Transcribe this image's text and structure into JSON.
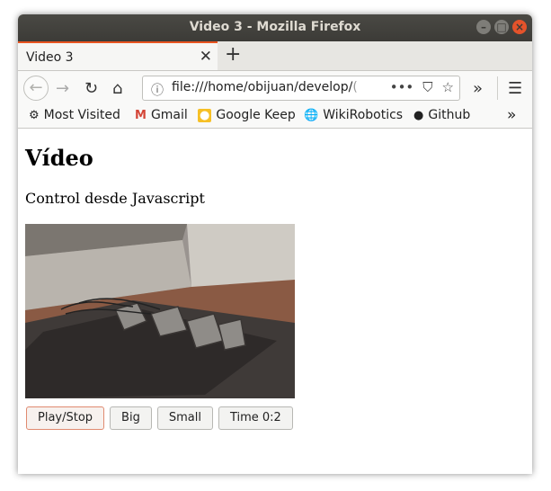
{
  "window": {
    "title": "Video 3 - Mozilla Firefox"
  },
  "tabs": [
    {
      "label": "Video 3"
    }
  ],
  "navigation": {
    "url_main": "file:///home/obijuan/develop/",
    "url_faded": "(",
    "icons": [
      "back-icon",
      "forward-icon",
      "reload-icon",
      "home-icon",
      "info-icon",
      "page-actions-icon",
      "pocket-icon",
      "bookmark-star-icon",
      "overflow-icon",
      "menu-icon"
    ]
  },
  "bookmarks": [
    {
      "label": "Most Visited",
      "icon": "gear-icon"
    },
    {
      "label": "Gmail",
      "icon": "gmail-icon"
    },
    {
      "label": "Google Keep",
      "icon": "keep-icon"
    },
    {
      "label": "WikiRobotics",
      "icon": "globe-icon"
    },
    {
      "label": "Github",
      "icon": "github-icon"
    }
  ],
  "page": {
    "heading": "Vídeo",
    "subtitle": "Control desde Javascript",
    "buttons": [
      {
        "label": "Play/Stop"
      },
      {
        "label": "Big"
      },
      {
        "label": "Small"
      },
      {
        "label": "Time 0:2"
      }
    ]
  }
}
